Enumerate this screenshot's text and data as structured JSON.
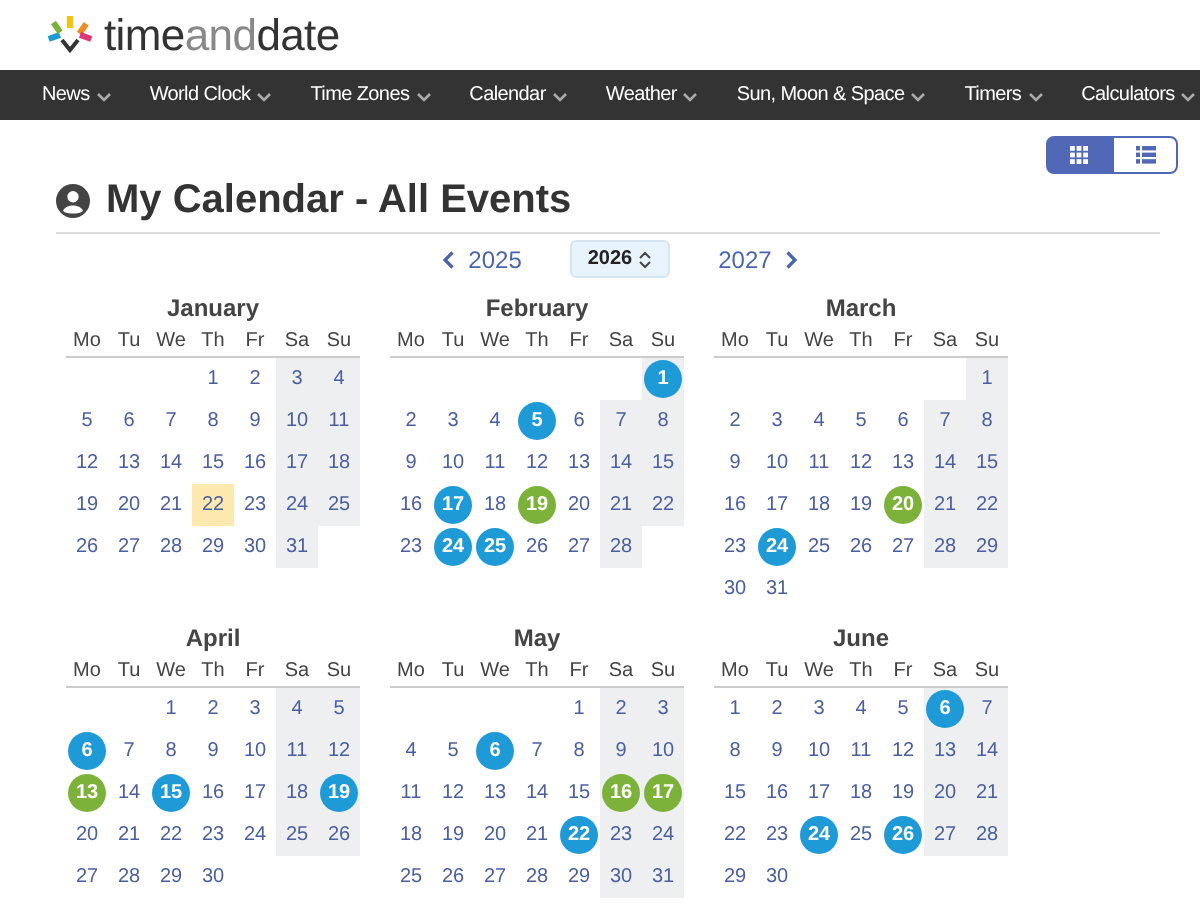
{
  "logo": {
    "parts": [
      "time",
      "and",
      "date"
    ]
  },
  "nav": [
    {
      "label": "News"
    },
    {
      "label": "World Clock"
    },
    {
      "label": "Time Zones"
    },
    {
      "label": "Calendar"
    },
    {
      "label": "Weather"
    },
    {
      "label": "Sun, Moon & Space"
    },
    {
      "label": "Timers"
    },
    {
      "label": "Calculators"
    }
  ],
  "view_buttons": [
    {
      "kind": "grid",
      "selected": true
    },
    {
      "kind": "list",
      "selected": false
    }
  ],
  "title": "My Calendar - All Events",
  "year_nav": {
    "prev": "2025",
    "current": "2026",
    "next": "2027"
  },
  "months": [
    {
      "name": "January",
      "weekdays": [
        "Mo",
        "Tu",
        "We",
        "Th",
        "Fr",
        "Sa",
        "Su"
      ],
      "weeks": [
        [
          {
            "kind": "blank"
          },
          {
            "kind": "blank"
          },
          {
            "kind": "blank"
          },
          {
            "kind": "day",
            "n": "1"
          },
          {
            "kind": "day",
            "n": "2"
          },
          {
            "kind": "day",
            "n": "3"
          },
          {
            "kind": "day",
            "n": "4"
          }
        ],
        [
          {
            "kind": "day",
            "n": "5"
          },
          {
            "kind": "day",
            "n": "6"
          },
          {
            "kind": "day",
            "n": "7"
          },
          {
            "kind": "day",
            "n": "8"
          },
          {
            "kind": "day",
            "n": "9"
          },
          {
            "kind": "day",
            "n": "10"
          },
          {
            "kind": "day",
            "n": "11"
          }
        ],
        [
          {
            "kind": "day",
            "n": "12"
          },
          {
            "kind": "day",
            "n": "13"
          },
          {
            "kind": "day",
            "n": "14"
          },
          {
            "kind": "day",
            "n": "15"
          },
          {
            "kind": "day",
            "n": "16"
          },
          {
            "kind": "day",
            "n": "17"
          },
          {
            "kind": "day",
            "n": "18"
          }
        ],
        [
          {
            "kind": "day",
            "n": "19"
          },
          {
            "kind": "day",
            "n": "20"
          },
          {
            "kind": "day",
            "n": "21"
          },
          {
            "kind": "today",
            "n": "22"
          },
          {
            "kind": "day",
            "n": "23"
          },
          {
            "kind": "day",
            "n": "24"
          },
          {
            "kind": "day",
            "n": "25"
          }
        ],
        [
          {
            "kind": "day",
            "n": "26"
          },
          {
            "kind": "day",
            "n": "27"
          },
          {
            "kind": "day",
            "n": "28"
          },
          {
            "kind": "day",
            "n": "29"
          },
          {
            "kind": "day",
            "n": "30"
          },
          {
            "kind": "day",
            "n": "31"
          },
          {
            "kind": "blank"
          }
        ]
      ]
    },
    {
      "name": "February",
      "weekdays": [
        "Mo",
        "Tu",
        "We",
        "Th",
        "Fr",
        "Sa",
        "Su"
      ],
      "weeks": [
        [
          {
            "kind": "blank"
          },
          {
            "kind": "blank"
          },
          {
            "kind": "blank"
          },
          {
            "kind": "blank"
          },
          {
            "kind": "blank"
          },
          {
            "kind": "blank"
          },
          {
            "kind": "event",
            "n": "1",
            "color": "#1e9bd7"
          }
        ],
        [
          {
            "kind": "day",
            "n": "2"
          },
          {
            "kind": "day",
            "n": "3"
          },
          {
            "kind": "day",
            "n": "4"
          },
          {
            "kind": "event",
            "n": "5",
            "color": "#1e9bd7"
          },
          {
            "kind": "day",
            "n": "6"
          },
          {
            "kind": "day",
            "n": "7"
          },
          {
            "kind": "day",
            "n": "8"
          }
        ],
        [
          {
            "kind": "day",
            "n": "9"
          },
          {
            "kind": "day",
            "n": "10"
          },
          {
            "kind": "day",
            "n": "11"
          },
          {
            "kind": "day",
            "n": "12"
          },
          {
            "kind": "day",
            "n": "13"
          },
          {
            "kind": "day",
            "n": "14"
          },
          {
            "kind": "day",
            "n": "15"
          }
        ],
        [
          {
            "kind": "day",
            "n": "16"
          },
          {
            "kind": "event",
            "n": "17",
            "color": "#1e9bd7"
          },
          {
            "kind": "day",
            "n": "18"
          },
          {
            "kind": "event",
            "n": "19",
            "color": "#7cb23a"
          },
          {
            "kind": "day",
            "n": "20"
          },
          {
            "kind": "day",
            "n": "21"
          },
          {
            "kind": "day",
            "n": "22"
          }
        ],
        [
          {
            "kind": "day",
            "n": "23"
          },
          {
            "kind": "event",
            "n": "24",
            "color": "#1e9bd7"
          },
          {
            "kind": "event",
            "n": "25",
            "color": "#1e9bd7"
          },
          {
            "kind": "day",
            "n": "26"
          },
          {
            "kind": "day",
            "n": "27"
          },
          {
            "kind": "day",
            "n": "28"
          },
          {
            "kind": "blank"
          }
        ]
      ]
    },
    {
      "name": "March",
      "weekdays": [
        "Mo",
        "Tu",
        "We",
        "Th",
        "Fr",
        "Sa",
        "Su"
      ],
      "weeks": [
        [
          {
            "kind": "blank"
          },
          {
            "kind": "blank"
          },
          {
            "kind": "blank"
          },
          {
            "kind": "blank"
          },
          {
            "kind": "blank"
          },
          {
            "kind": "blank"
          },
          {
            "kind": "day",
            "n": "1"
          }
        ],
        [
          {
            "kind": "day",
            "n": "2"
          },
          {
            "kind": "day",
            "n": "3"
          },
          {
            "kind": "day",
            "n": "4"
          },
          {
            "kind": "day",
            "n": "5"
          },
          {
            "kind": "day",
            "n": "6"
          },
          {
            "kind": "day",
            "n": "7"
          },
          {
            "kind": "day",
            "n": "8"
          }
        ],
        [
          {
            "kind": "day",
            "n": "9"
          },
          {
            "kind": "day",
            "n": "10"
          },
          {
            "kind": "day",
            "n": "11"
          },
          {
            "kind": "day",
            "n": "12"
          },
          {
            "kind": "day",
            "n": "13"
          },
          {
            "kind": "day",
            "n": "14"
          },
          {
            "kind": "day",
            "n": "15"
          }
        ],
        [
          {
            "kind": "day",
            "n": "16"
          },
          {
            "kind": "day",
            "n": "17"
          },
          {
            "kind": "day",
            "n": "18"
          },
          {
            "kind": "day",
            "n": "19"
          },
          {
            "kind": "event",
            "n": "20",
            "color": "#7cb23a"
          },
          {
            "kind": "day",
            "n": "21"
          },
          {
            "kind": "day",
            "n": "22"
          }
        ],
        [
          {
            "kind": "day",
            "n": "23"
          },
          {
            "kind": "event",
            "n": "24",
            "color": "#1e9bd7"
          },
          {
            "kind": "day",
            "n": "25"
          },
          {
            "kind": "day",
            "n": "26"
          },
          {
            "kind": "day",
            "n": "27"
          },
          {
            "kind": "day",
            "n": "28"
          },
          {
            "kind": "day",
            "n": "29"
          }
        ],
        [
          {
            "kind": "day",
            "n": "30"
          },
          {
            "kind": "day",
            "n": "31"
          },
          {
            "kind": "blank"
          },
          {
            "kind": "blank"
          },
          {
            "kind": "blank"
          },
          {
            "kind": "blank"
          },
          {
            "kind": "blank"
          }
        ]
      ]
    },
    {
      "name": "April",
      "weekdays": [
        "Mo",
        "Tu",
        "We",
        "Th",
        "Fr",
        "Sa",
        "Su"
      ],
      "weeks": [
        [
          {
            "kind": "blank"
          },
          {
            "kind": "blank"
          },
          {
            "kind": "day",
            "n": "1"
          },
          {
            "kind": "day",
            "n": "2"
          },
          {
            "kind": "day",
            "n": "3"
          },
          {
            "kind": "day",
            "n": "4"
          },
          {
            "kind": "day",
            "n": "5"
          }
        ],
        [
          {
            "kind": "event",
            "n": "6",
            "color": "#1e9bd7"
          },
          {
            "kind": "day",
            "n": "7"
          },
          {
            "kind": "day",
            "n": "8"
          },
          {
            "kind": "day",
            "n": "9"
          },
          {
            "kind": "day",
            "n": "10"
          },
          {
            "kind": "day",
            "n": "11"
          },
          {
            "kind": "day",
            "n": "12"
          }
        ],
        [
          {
            "kind": "event",
            "n": "13",
            "color": "#7cb23a"
          },
          {
            "kind": "day",
            "n": "14"
          },
          {
            "kind": "event",
            "n": "15",
            "color": "#1e9bd7"
          },
          {
            "kind": "day",
            "n": "16"
          },
          {
            "kind": "day",
            "n": "17"
          },
          {
            "kind": "day",
            "n": "18"
          },
          {
            "kind": "event",
            "n": "19",
            "color": "#1e9bd7"
          }
        ],
        [
          {
            "kind": "day",
            "n": "20"
          },
          {
            "kind": "day",
            "n": "21"
          },
          {
            "kind": "day",
            "n": "22"
          },
          {
            "kind": "day",
            "n": "23"
          },
          {
            "kind": "day",
            "n": "24"
          },
          {
            "kind": "day",
            "n": "25"
          },
          {
            "kind": "day",
            "n": "26"
          }
        ],
        [
          {
            "kind": "day",
            "n": "27"
          },
          {
            "kind": "day",
            "n": "28"
          },
          {
            "kind": "day",
            "n": "29"
          },
          {
            "kind": "day",
            "n": "30"
          },
          {
            "kind": "blank"
          },
          {
            "kind": "blank"
          },
          {
            "kind": "blank"
          }
        ]
      ]
    },
    {
      "name": "May",
      "weekdays": [
        "Mo",
        "Tu",
        "We",
        "Th",
        "Fr",
        "Sa",
        "Su"
      ],
      "weeks": [
        [
          {
            "kind": "blank"
          },
          {
            "kind": "blank"
          },
          {
            "kind": "blank"
          },
          {
            "kind": "blank"
          },
          {
            "kind": "day",
            "n": "1"
          },
          {
            "kind": "day",
            "n": "2"
          },
          {
            "kind": "day",
            "n": "3"
          }
        ],
        [
          {
            "kind": "day",
            "n": "4"
          },
          {
            "kind": "day",
            "n": "5"
          },
          {
            "kind": "event",
            "n": "6",
            "color": "#1e9bd7"
          },
          {
            "kind": "day",
            "n": "7"
          },
          {
            "kind": "day",
            "n": "8"
          },
          {
            "kind": "day",
            "n": "9"
          },
          {
            "kind": "day",
            "n": "10"
          }
        ],
        [
          {
            "kind": "day",
            "n": "11"
          },
          {
            "kind": "day",
            "n": "12"
          },
          {
            "kind": "day",
            "n": "13"
          },
          {
            "kind": "day",
            "n": "14"
          },
          {
            "kind": "day",
            "n": "15"
          },
          {
            "kind": "event",
            "n": "16",
            "color": "#7cb23a"
          },
          {
            "kind": "event",
            "n": "17",
            "color": "#7cb23a"
          }
        ],
        [
          {
            "kind": "day",
            "n": "18"
          },
          {
            "kind": "day",
            "n": "19"
          },
          {
            "kind": "day",
            "n": "20"
          },
          {
            "kind": "day",
            "n": "21"
          },
          {
            "kind": "event",
            "n": "22",
            "color": "#1e9bd7"
          },
          {
            "kind": "day",
            "n": "23"
          },
          {
            "kind": "day",
            "n": "24"
          }
        ],
        [
          {
            "kind": "day",
            "n": "25"
          },
          {
            "kind": "day",
            "n": "26"
          },
          {
            "kind": "day",
            "n": "27"
          },
          {
            "kind": "day",
            "n": "28"
          },
          {
            "kind": "day",
            "n": "29"
          },
          {
            "kind": "day",
            "n": "30"
          },
          {
            "kind": "day",
            "n": "31"
          }
        ]
      ]
    },
    {
      "name": "June",
      "weekdays": [
        "Mo",
        "Tu",
        "We",
        "Th",
        "Fr",
        "Sa",
        "Su"
      ],
      "weeks": [
        [
          {
            "kind": "day",
            "n": "1"
          },
          {
            "kind": "day",
            "n": "2"
          },
          {
            "kind": "day",
            "n": "3"
          },
          {
            "kind": "day",
            "n": "4"
          },
          {
            "kind": "day",
            "n": "5"
          },
          {
            "kind": "event",
            "n": "6",
            "color": "#1e9bd7"
          },
          {
            "kind": "day",
            "n": "7"
          }
        ],
        [
          {
            "kind": "day",
            "n": "8"
          },
          {
            "kind": "day",
            "n": "9"
          },
          {
            "kind": "day",
            "n": "10"
          },
          {
            "kind": "day",
            "n": "11"
          },
          {
            "kind": "day",
            "n": "12"
          },
          {
            "kind": "day",
            "n": "13"
          },
          {
            "kind": "day",
            "n": "14"
          }
        ],
        [
          {
            "kind": "day",
            "n": "15"
          },
          {
            "kind": "day",
            "n": "16"
          },
          {
            "kind": "day",
            "n": "17"
          },
          {
            "kind": "day",
            "n": "18"
          },
          {
            "kind": "day",
            "n": "19"
          },
          {
            "kind": "day",
            "n": "20"
          },
          {
            "kind": "day",
            "n": "21"
          }
        ],
        [
          {
            "kind": "day",
            "n": "22"
          },
          {
            "kind": "day",
            "n": "23"
          },
          {
            "kind": "event",
            "n": "24",
            "color": "#1e9bd7"
          },
          {
            "kind": "day",
            "n": "25"
          },
          {
            "kind": "event",
            "n": "26",
            "color": "#1e9bd7"
          },
          {
            "kind": "day",
            "n": "27"
          },
          {
            "kind": "day",
            "n": "28"
          }
        ],
        [
          {
            "kind": "day",
            "n": "29"
          },
          {
            "kind": "day",
            "n": "30"
          },
          {
            "kind": "blank"
          },
          {
            "kind": "blank"
          },
          {
            "kind": "blank"
          },
          {
            "kind": "blank"
          },
          {
            "kind": "blank"
          }
        ]
      ]
    }
  ]
}
